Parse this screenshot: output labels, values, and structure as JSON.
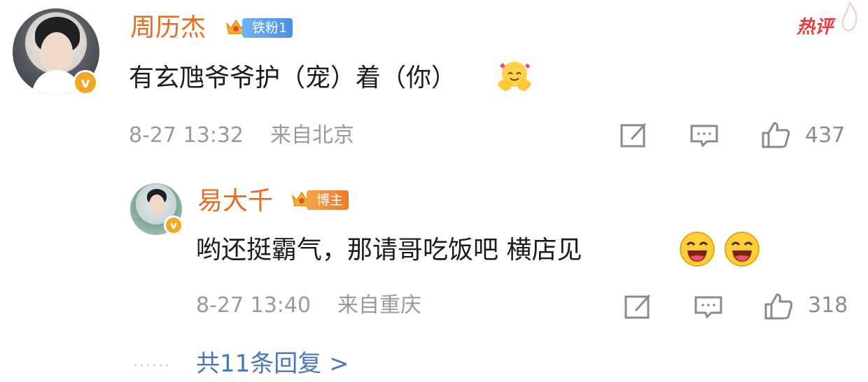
{
  "top_comment": {
    "author": "周历杰",
    "badge": "铁粉1",
    "hot_label": "热评",
    "text": "有玄虺爷爷护（宠）着（你）",
    "emoji": "hugging-face-emoji",
    "date": "8-27 13:32",
    "location": "来自北京",
    "likes": "437"
  },
  "reply": {
    "author": "易大千",
    "badge": "博主",
    "text": "哟还挺霸气，那请哥吃饭吧 横店见",
    "emojis": [
      "laughing-face-emoji",
      "laughing-face-emoji"
    ],
    "date": "8-27 13:40",
    "location": "来自重庆",
    "likes": "318"
  },
  "more": {
    "dots": "······",
    "label": "共11条回复 >"
  },
  "colors": {
    "username": "#e86b1f",
    "link": "#4a78b8",
    "hot": "#ea3c3c",
    "meta": "#9a9a9a",
    "verified": "#f5a623"
  }
}
